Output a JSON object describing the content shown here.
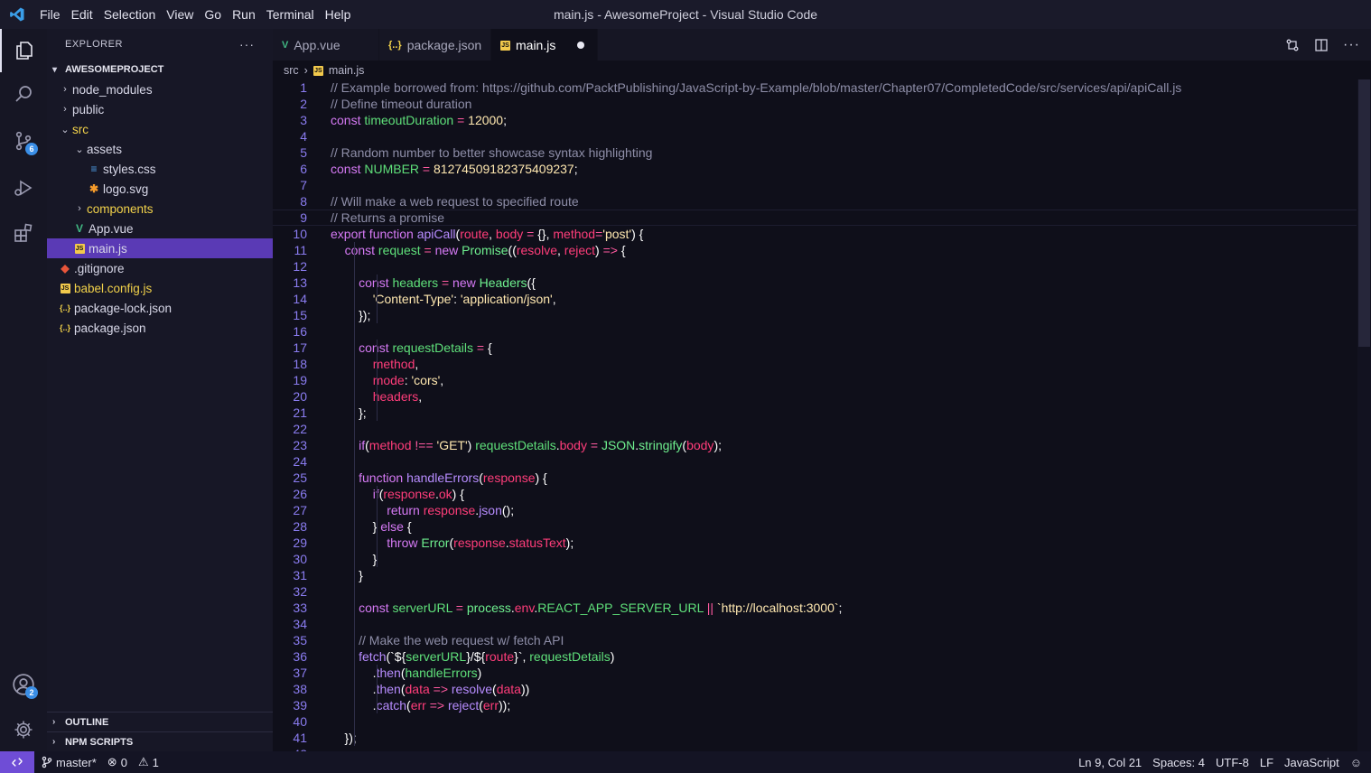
{
  "titlebar": {
    "menu": [
      "File",
      "Edit",
      "Selection",
      "View",
      "Go",
      "Run",
      "Terminal",
      "Help"
    ],
    "window_title": "main.js - AwesomeProject - Visual Studio Code"
  },
  "activitybar": {
    "items": [
      "files-icon",
      "search-icon",
      "source-control-icon",
      "run-debug-icon",
      "extensions-icon"
    ],
    "source_control_badge": "6",
    "accounts_badge": "2"
  },
  "sidebar": {
    "title": "EXPLORER",
    "more": "···",
    "project": "AWESOMEPROJECT",
    "tree": [
      {
        "label": "node_modules",
        "type": "folder",
        "depth": 0,
        "expanded": false
      },
      {
        "label": "public",
        "type": "folder",
        "depth": 0,
        "expanded": false
      },
      {
        "label": "src",
        "type": "folder",
        "depth": 0,
        "expanded": true
      },
      {
        "label": "assets",
        "type": "folder",
        "depth": 1,
        "expanded": true
      },
      {
        "label": "styles.css",
        "type": "css",
        "depth": 2
      },
      {
        "label": "logo.svg",
        "type": "svg",
        "depth": 2
      },
      {
        "label": "components",
        "type": "folder",
        "depth": 1,
        "expanded": false
      },
      {
        "label": "App.vue",
        "type": "vue",
        "depth": 1
      },
      {
        "label": "main.js",
        "type": "js",
        "depth": 1,
        "selected": true
      },
      {
        "label": ".gitignore",
        "type": "git",
        "depth": 0
      },
      {
        "label": "babel.config.js",
        "type": "js",
        "depth": 0
      },
      {
        "label": "package-lock.json",
        "type": "json",
        "depth": 0
      },
      {
        "label": "package.json",
        "type": "json",
        "depth": 0
      }
    ],
    "sections": [
      "OUTLINE",
      "NPM SCRIPTS"
    ]
  },
  "tabs": [
    {
      "label": "App.vue",
      "icon": "V",
      "active": false
    },
    {
      "label": "package.json",
      "icon": "{..}",
      "active": false
    },
    {
      "label": "main.js",
      "icon": "JS",
      "active": true,
      "modified": true
    }
  ],
  "breadcrumb": {
    "folder": "src",
    "file": "main.js"
  },
  "editor": {
    "lines": [
      [
        [
          "c",
          "// Example borrowed from: https://github.com/PacktPublishing/JavaScript-by-Example/blob/master/Chapter07/CompletedCode/src/services/api/apiCall.js"
        ]
      ],
      [
        [
          "c",
          "// Define timeout duration"
        ]
      ],
      [
        [
          "k",
          "const "
        ],
        [
          "v",
          "timeoutDuration"
        ],
        [
          "o",
          " = "
        ],
        [
          "n",
          "12000"
        ],
        [
          "p",
          ";"
        ]
      ],
      [],
      [
        [
          "c",
          "// Random number to better showcase syntax highlighting"
        ]
      ],
      [
        [
          "k",
          "const "
        ],
        [
          "v",
          "NUMBER"
        ],
        [
          "o",
          " = "
        ],
        [
          "n",
          "8127450918237540923 7"
        ],
        [
          "p",
          ";"
        ]
      ],
      [],
      [
        [
          "c",
          "// Will make a web request to specified route"
        ]
      ],
      [
        [
          "c",
          "// Returns a promise"
        ]
      ],
      [
        [
          "k",
          "export function "
        ],
        [
          "f",
          "apiCall"
        ],
        [
          "p",
          "("
        ],
        [
          "a",
          "route"
        ],
        [
          "p",
          ", "
        ],
        [
          "a",
          "body"
        ],
        [
          "o",
          " = "
        ],
        [
          "p",
          "{}, "
        ],
        [
          "a",
          "method"
        ],
        [
          "o",
          "="
        ],
        [
          "s",
          "'post'"
        ],
        [
          "p",
          ") {"
        ]
      ],
      [
        [
          "p",
          "    "
        ],
        [
          "k",
          "const "
        ],
        [
          "v",
          "request"
        ],
        [
          "o",
          " = "
        ],
        [
          "k",
          "new "
        ],
        [
          "x",
          "Promise"
        ],
        [
          "p",
          "(("
        ],
        [
          "a",
          "resolve"
        ],
        [
          "p",
          ", "
        ],
        [
          "a",
          "reject"
        ],
        [
          "p",
          ") "
        ],
        [
          "o",
          "=>"
        ],
        [
          "p",
          " {"
        ]
      ],
      [],
      [
        [
          "p",
          "        "
        ],
        [
          "k",
          "const "
        ],
        [
          "v",
          "headers"
        ],
        [
          "o",
          " = "
        ],
        [
          "k",
          "new "
        ],
        [
          "x",
          "Headers"
        ],
        [
          "p",
          "({"
        ]
      ],
      [
        [
          "p",
          "            "
        ],
        [
          "s",
          "'Content-Type'"
        ],
        [
          "p",
          ": "
        ],
        [
          "s",
          "'application/json'"
        ],
        [
          "p",
          ","
        ]
      ],
      [
        [
          "p",
          "        });"
        ]
      ],
      [],
      [
        [
          "p",
          "        "
        ],
        [
          "k",
          "const "
        ],
        [
          "v",
          "requestDetails"
        ],
        [
          "o",
          " = "
        ],
        [
          "p",
          "{"
        ]
      ],
      [
        [
          "p",
          "            "
        ],
        [
          "a",
          "method"
        ],
        [
          "p",
          ","
        ]
      ],
      [
        [
          "p",
          "            "
        ],
        [
          "a",
          "mode"
        ],
        [
          "p",
          ": "
        ],
        [
          "s",
          "'cors'"
        ],
        [
          "p",
          ","
        ]
      ],
      [
        [
          "p",
          "            "
        ],
        [
          "a",
          "headers"
        ],
        [
          "p",
          ","
        ]
      ],
      [
        [
          "p",
          "        };"
        ]
      ],
      [],
      [
        [
          "p",
          "        "
        ],
        [
          "k",
          "if"
        ],
        [
          "p",
          "("
        ],
        [
          "a",
          "method"
        ],
        [
          "o",
          " !== "
        ],
        [
          "s",
          "'GET'"
        ],
        [
          "p",
          ") "
        ],
        [
          "v",
          "requestDetails"
        ],
        [
          "p",
          "."
        ],
        [
          "a",
          "body"
        ],
        [
          "o",
          " = "
        ],
        [
          "x",
          "JSON"
        ],
        [
          "p",
          "."
        ],
        [
          "x",
          "stringify"
        ],
        [
          "p",
          "("
        ],
        [
          "a",
          "body"
        ],
        [
          "p",
          ");"
        ]
      ],
      [],
      [
        [
          "p",
          "        "
        ],
        [
          "k",
          "function "
        ],
        [
          "f",
          "handleErrors"
        ],
        [
          "p",
          "("
        ],
        [
          "a",
          "response"
        ],
        [
          "p",
          ") {"
        ]
      ],
      [
        [
          "p",
          "            "
        ],
        [
          "k",
          "if"
        ],
        [
          "p",
          "("
        ],
        [
          "a",
          "response"
        ],
        [
          "p",
          "."
        ],
        [
          "a",
          "ok"
        ],
        [
          "p",
          ") {"
        ]
      ],
      [
        [
          "p",
          "                "
        ],
        [
          "k",
          "return "
        ],
        [
          "a",
          "response"
        ],
        [
          "p",
          "."
        ],
        [
          "f",
          "json"
        ],
        [
          "p",
          "();"
        ]
      ],
      [
        [
          "p",
          "            } "
        ],
        [
          "k",
          "else"
        ],
        [
          "p",
          " {"
        ]
      ],
      [
        [
          "p",
          "                "
        ],
        [
          "k",
          "throw "
        ],
        [
          "x",
          "Error"
        ],
        [
          "p",
          "("
        ],
        [
          "a",
          "response"
        ],
        [
          "p",
          "."
        ],
        [
          "a",
          "statusText"
        ],
        [
          "p",
          ");"
        ]
      ],
      [
        [
          "p",
          "            }"
        ]
      ],
      [
        [
          "p",
          "        }"
        ]
      ],
      [],
      [
        [
          "p",
          "        "
        ],
        [
          "k",
          "const "
        ],
        [
          "v",
          "serverURL"
        ],
        [
          "o",
          " = "
        ],
        [
          "x",
          "process"
        ],
        [
          "p",
          "."
        ],
        [
          "a",
          "env"
        ],
        [
          "p",
          "."
        ],
        [
          "v",
          "REACT_APP_SERVER_URL"
        ],
        [
          "o",
          " || "
        ],
        [
          "s",
          "`http://localhost:3000`"
        ],
        [
          "p",
          ";"
        ]
      ],
      [],
      [
        [
          "p",
          "        "
        ],
        [
          "c",
          "// Make the web request w/ fetch API"
        ]
      ],
      [
        [
          "p",
          "        "
        ],
        [
          "f",
          "fetch"
        ],
        [
          "p",
          "(`${"
        ],
        [
          "v",
          "serverURL"
        ],
        [
          "p",
          "}/${"
        ],
        [
          "a",
          "route"
        ],
        [
          "p",
          "}`, "
        ],
        [
          "v",
          "requestDetails"
        ],
        [
          "p",
          ")"
        ]
      ],
      [
        [
          "p",
          "            ."
        ],
        [
          "f",
          "then"
        ],
        [
          "p",
          "("
        ],
        [
          "v",
          "handleErrors"
        ],
        [
          "p",
          ")"
        ]
      ],
      [
        [
          "p",
          "            ."
        ],
        [
          "f",
          "then"
        ],
        [
          "p",
          "("
        ],
        [
          "a",
          "data"
        ],
        [
          "o",
          " => "
        ],
        [
          "f",
          "resolve"
        ],
        [
          "p",
          "("
        ],
        [
          "a",
          "data"
        ],
        [
          "p",
          "))"
        ]
      ],
      [
        [
          "p",
          "            ."
        ],
        [
          "f",
          "catch"
        ],
        [
          "p",
          "("
        ],
        [
          "a",
          "err"
        ],
        [
          "o",
          " => "
        ],
        [
          "f",
          "reject"
        ],
        [
          "p",
          "("
        ],
        [
          "a",
          "err"
        ],
        [
          "p",
          "));"
        ]
      ],
      [],
      [
        [
          "p",
          "    });"
        ]
      ],
      []
    ]
  },
  "statusbar": {
    "branch": "master*",
    "errors": "0",
    "warnings": "1",
    "position": "Ln 9, Col 21",
    "spaces": "Spaces: 4",
    "encoding": "UTF-8",
    "eol": "LF",
    "language": "JavaScript"
  }
}
